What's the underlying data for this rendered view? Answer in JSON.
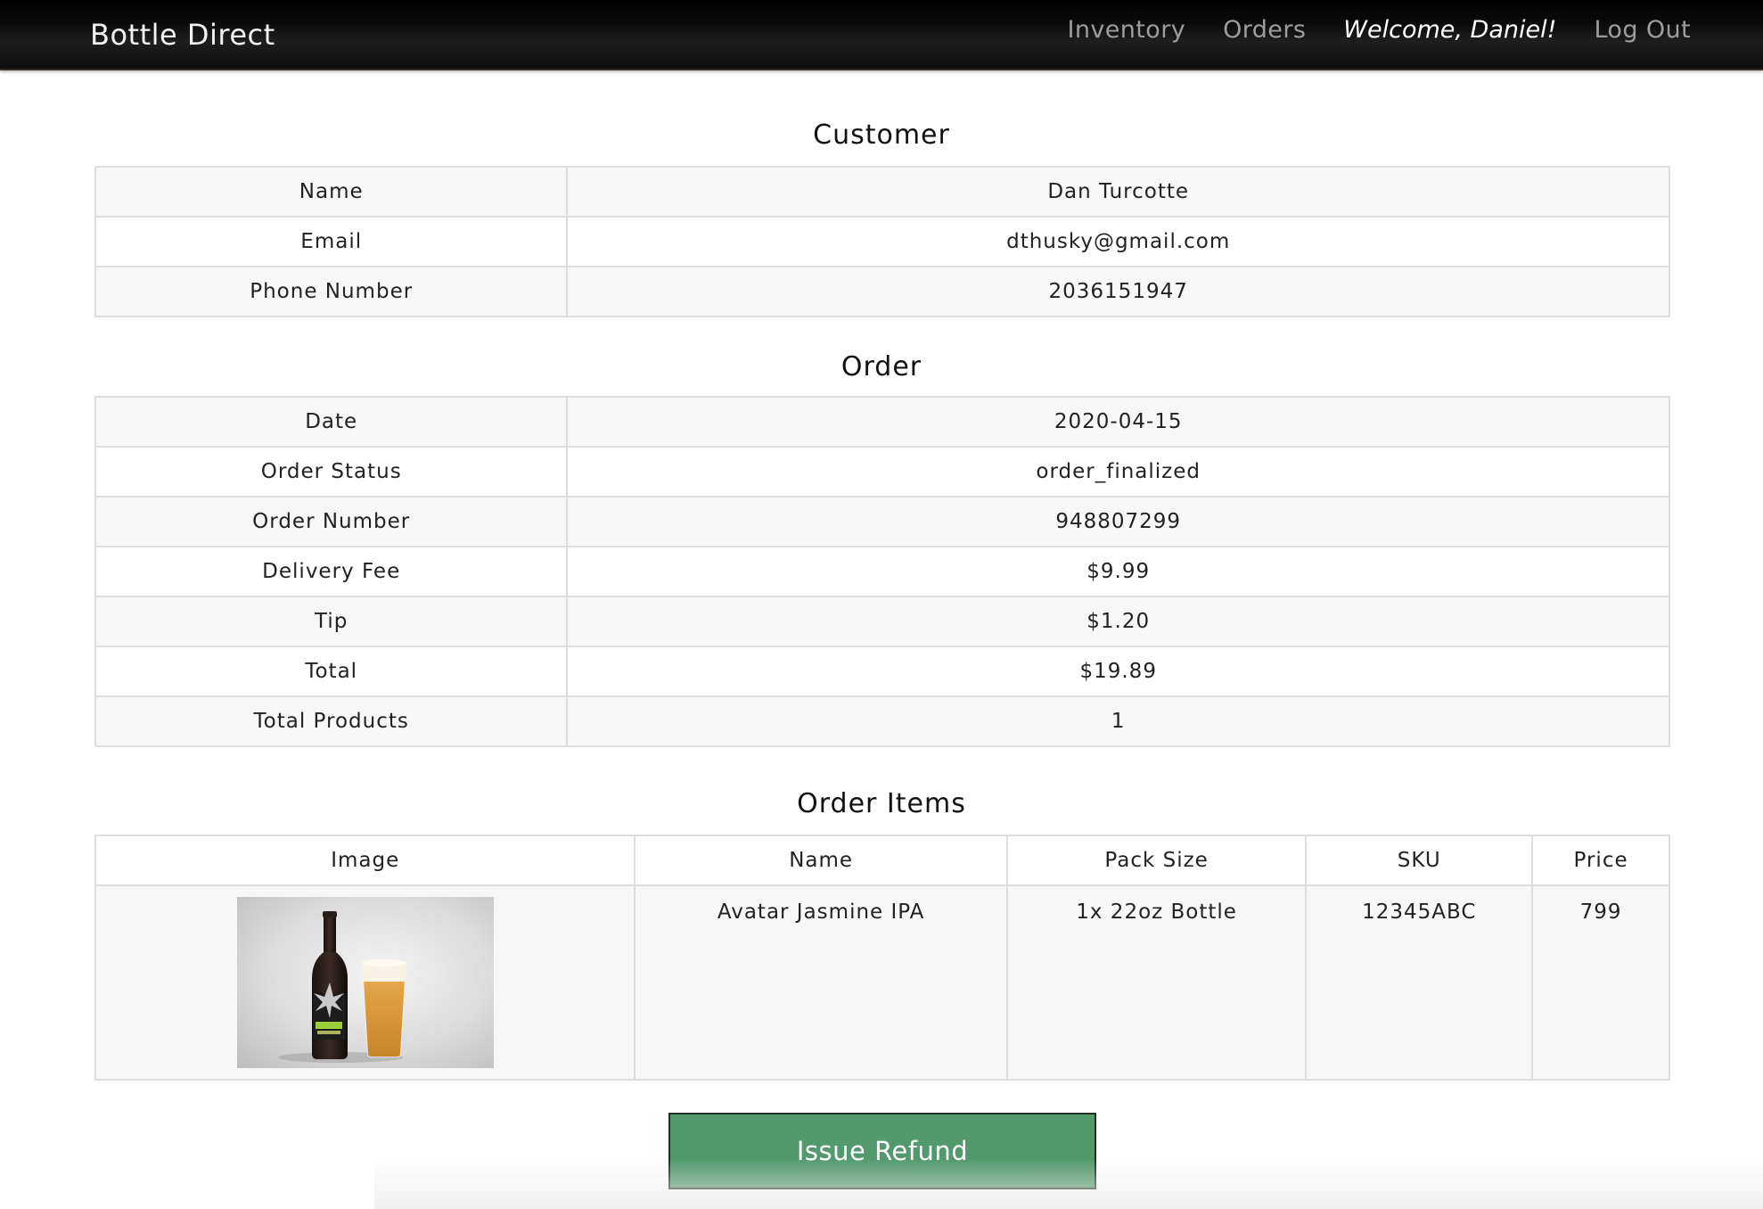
{
  "navbar": {
    "brand": "Bottle Direct",
    "links": {
      "inventory": "Inventory",
      "orders": "Orders",
      "welcome": "Welcome, Daniel!",
      "logout": "Log Out"
    }
  },
  "customer": {
    "title": "Customer",
    "rows": [
      {
        "label": "Name",
        "value": "Dan Turcotte"
      },
      {
        "label": "Email",
        "value": "dthusky@gmail.com"
      },
      {
        "label": "Phone Number",
        "value": "2036151947"
      }
    ]
  },
  "order": {
    "title": "Order",
    "rows": [
      {
        "label": "Date",
        "value": "2020-04-15"
      },
      {
        "label": "Order Status",
        "value": "order_finalized"
      },
      {
        "label": "Order Number",
        "value": "948807299"
      },
      {
        "label": "Delivery Fee",
        "value": "$9.99"
      },
      {
        "label": "Tip",
        "value": "$1.20"
      },
      {
        "label": "Total",
        "value": "$19.89"
      },
      {
        "label": "Total Products",
        "value": "1"
      }
    ]
  },
  "order_items": {
    "title": "Order Items",
    "headers": [
      "Image",
      "Name",
      "Pack Size",
      "SKU",
      "Price"
    ],
    "rows": [
      {
        "name": "Avatar Jasmine IPA",
        "pack_size": "1x 22oz Bottle",
        "sku": "12345ABC",
        "price": "799"
      }
    ]
  },
  "actions": {
    "refund_label": "Issue Refund"
  },
  "colors": {
    "navbar": "#000000",
    "refund_button": "#529a6c",
    "table_stripe": "#f7f7f7",
    "table_border": "#dddddd"
  }
}
